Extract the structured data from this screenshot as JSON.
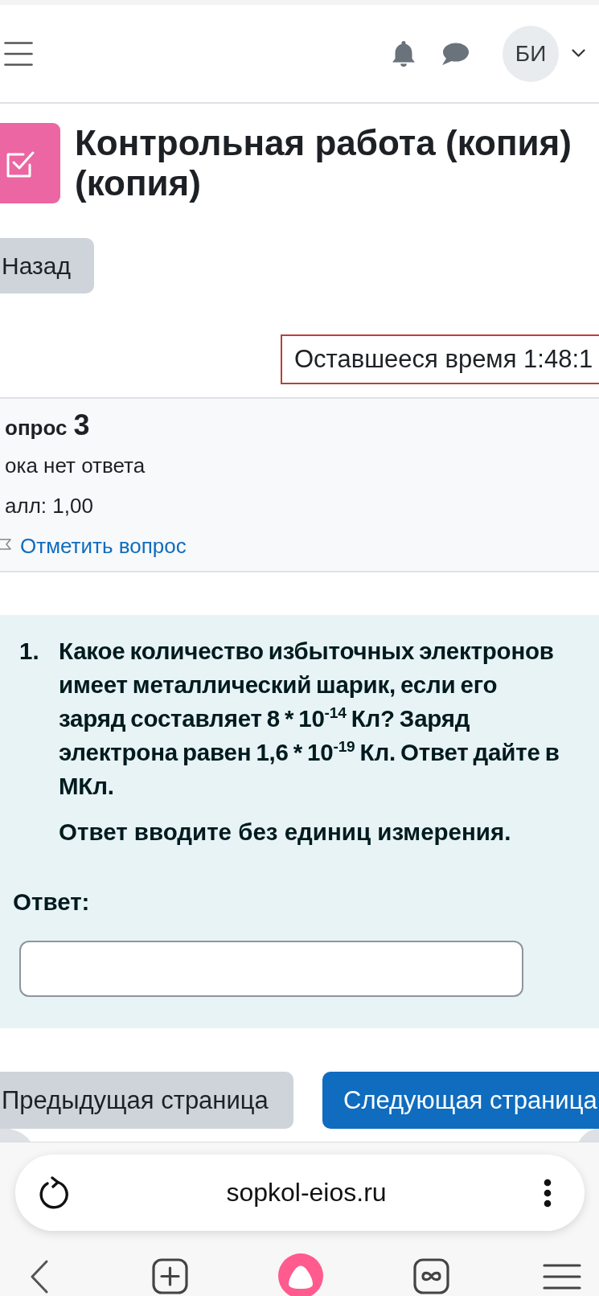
{
  "header": {
    "avatar_initials": "БИ"
  },
  "page": {
    "title": "Контрольная работа (копия) (копия)",
    "back_button": "Назад",
    "timer": "Оставшееся время 1:48:1"
  },
  "question_info": {
    "title": "опрос",
    "number": "3",
    "status": "ока нет ответа",
    "grade": "алл: 1,00",
    "flag_link": "Отметить вопрос",
    "flagged": false
  },
  "question": {
    "items": [
      {
        "marker": "1.",
        "text": "Какое количество избыточных электронов имеет металлический шарик, если его заряд составляет 8 * 10$^{-14}$ Кл? Заряд электрона равен 1,6 * 10$^{-19}$ Кл. Ответ дайте в МКл.",
        "note": "Ответ вводите без единиц измерения."
      }
    ],
    "answer_label": "Ответ:"
  },
  "navigation": {
    "previous": "Предыдущая страница",
    "next": "Следующая страница"
  },
  "browser": {
    "url": "sopkol-eios.ru"
  }
}
